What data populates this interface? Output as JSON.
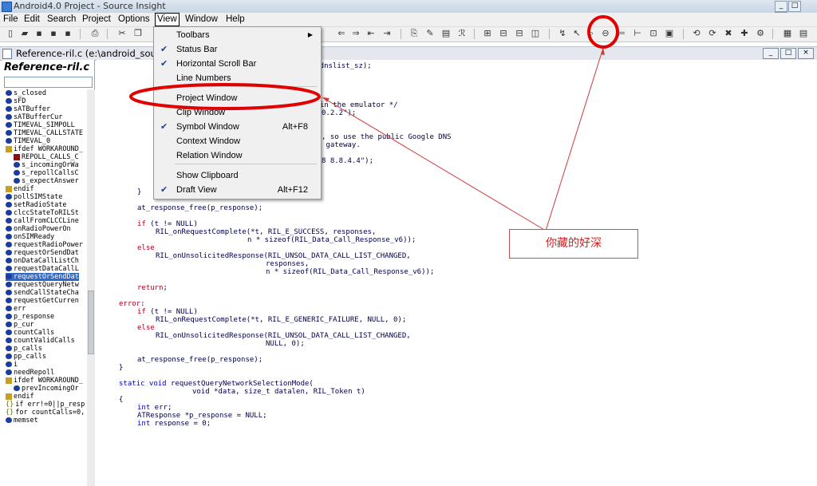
{
  "window": {
    "title": "Android4.0 Project - Source Insight"
  },
  "menubar": [
    "File",
    "Edit",
    "Search",
    "Project",
    "Options",
    "View",
    "Window",
    "Help"
  ],
  "document": {
    "title": "Reference-ril.c (e:\\android_source\\..."
  },
  "symbol_window": {
    "header": "Reference-ril.c",
    "items": [
      {
        "icon": "dot",
        "label": "s_closed"
      },
      {
        "icon": "dot",
        "label": "sFD"
      },
      {
        "icon": "dot",
        "label": "sATBuffer"
      },
      {
        "icon": "dot",
        "label": "sATBufferCur"
      },
      {
        "icon": "dot",
        "label": "TIMEVAL_SIMPOLL"
      },
      {
        "icon": "dot",
        "label": "TIMEVAL_CALLSTATE"
      },
      {
        "icon": "dot",
        "label": "TIMEVAL_0"
      },
      {
        "icon": "hash",
        "label": "ifdef WORKAROUND_"
      },
      {
        "icon": "lock",
        "label": "REPOLL_CALLS_C",
        "indent": true
      },
      {
        "icon": "dot",
        "label": "s_incomingOrWa",
        "indent": true
      },
      {
        "icon": "dot",
        "label": "s_repollCallsC",
        "indent": true
      },
      {
        "icon": "dot",
        "label": "s_expectAnswer",
        "indent": true
      },
      {
        "icon": "hash",
        "label": "endif"
      },
      {
        "icon": "dot",
        "label": "pollSIMState"
      },
      {
        "icon": "dot",
        "label": "setRadioState"
      },
      {
        "icon": "dot",
        "label": "clccStateToRILSt"
      },
      {
        "icon": "dot",
        "label": "callFromCLCCLine"
      },
      {
        "icon": "dot",
        "label": "onRadioPowerOn"
      },
      {
        "icon": "dot",
        "label": "onSIMReady"
      },
      {
        "icon": "dot",
        "label": "requestRadioPower"
      },
      {
        "icon": "dot",
        "label": "requestOrSendDat"
      },
      {
        "icon": "dot",
        "label": "onDataCallListCh"
      },
      {
        "icon": "dot",
        "label": "requestDataCallL"
      },
      {
        "icon": "dot",
        "label": "requestOrSendDat",
        "selected": true
      },
      {
        "icon": "dot",
        "label": "requestQueryNetw"
      },
      {
        "icon": "dot",
        "label": "sendCallStateCha"
      },
      {
        "icon": "dot",
        "label": "requestGetCurren"
      },
      {
        "icon": "dot",
        "label": "err"
      },
      {
        "icon": "dot",
        "label": "p_response"
      },
      {
        "icon": "dot",
        "label": "p_cur"
      },
      {
        "icon": "dot",
        "label": "countCalls"
      },
      {
        "icon": "dot",
        "label": "countValidCalls"
      },
      {
        "icon": "dot",
        "label": "p_calls"
      },
      {
        "icon": "dot",
        "label": "pp_calls"
      },
      {
        "icon": "dot",
        "label": "i"
      },
      {
        "icon": "dot",
        "label": "needRepoll"
      },
      {
        "icon": "hash",
        "label": "ifdef WORKAROUND_"
      },
      {
        "icon": "dot",
        "label": "prevIncomingOr",
        "indent": true
      },
      {
        "icon": "hash",
        "label": "endif"
      },
      {
        "icon": "brace",
        "label": "if err!=0||p_resp"
      },
      {
        "icon": "brace",
        "label": "for countCalls=0,"
      },
      {
        "icon": "dot",
        "label": "memset"
      }
    ]
  },
  "view_menu": {
    "items": [
      {
        "label": "Toolbars",
        "checked": false,
        "submenu": true,
        "shortcut": ""
      },
      {
        "label": "Status Bar",
        "checked": true,
        "submenu": false,
        "shortcut": ""
      },
      {
        "label": "Horizontal Scroll Bar",
        "checked": true,
        "submenu": false,
        "shortcut": ""
      },
      {
        "label": "Line Numbers",
        "checked": false,
        "submenu": false,
        "shortcut": ""
      },
      {
        "label": "Project Window",
        "checked": false,
        "submenu": false,
        "shortcut": ""
      },
      {
        "label": "Clip Window",
        "checked": false,
        "submenu": false,
        "shortcut": ""
      },
      {
        "label": "Symbol Window",
        "checked": true,
        "submenu": false,
        "shortcut": "Alt+F8"
      },
      {
        "label": "Context Window",
        "checked": false,
        "submenu": false,
        "shortcut": ""
      },
      {
        "label": "Relation Window",
        "checked": false,
        "submenu": false,
        "shortcut": ""
      },
      {
        "label": "Show Clipboard",
        "checked": false,
        "submenu": false,
        "shortcut": ""
      },
      {
        "label": "Draft View",
        "checked": true,
        "submenu": false,
        "shortcut": "Alt+F12"
      }
    ]
  },
  "code_fragments": {
    "l1": "ue, dnslist_sz);",
    "l2": "in the emulator */",
    "l3": "0.2.2\");",
    "l4": ", so use the public Google DNS",
    "l5": " gateway.",
    "l6": "8 8.8.4.4\");"
  },
  "code_lines": [
    {
      "indent": 1,
      "text": "}"
    },
    {
      "indent": 0,
      "text": ""
    },
    {
      "indent": 1,
      "text": "at_response_free(p_response);"
    },
    {
      "indent": 0,
      "text": ""
    },
    {
      "indent": 1,
      "kw": "if",
      "text": " (t != NULL)"
    },
    {
      "indent": 2,
      "text": "RIL_onRequestComplete(*t, RIL_E_SUCCESS, responses,"
    },
    {
      "indent": 7,
      "text": "n * sizeof(RIL_Data_Call_Response_v6));"
    },
    {
      "indent": 1,
      "kw": "else",
      "text": ""
    },
    {
      "indent": 2,
      "text": "RIL_onUnsolicitedResponse(RIL_UNSOL_DATA_CALL_LIST_CHANGED,"
    },
    {
      "indent": 8,
      "text": "responses,"
    },
    {
      "indent": 8,
      "text": "n * sizeof(RIL_Data_Call_Response_v6));"
    },
    {
      "indent": 0,
      "text": ""
    },
    {
      "indent": 1,
      "kw": "return",
      "text": ";"
    },
    {
      "indent": 0,
      "text": ""
    },
    {
      "indent": 0,
      "kw": "error",
      "text": ":"
    },
    {
      "indent": 1,
      "kw": "if",
      "text": " (t != NULL)"
    },
    {
      "indent": 2,
      "text": "RIL_onRequestComplete(*t, RIL_E_GENERIC_FAILURE, NULL, 0);"
    },
    {
      "indent": 1,
      "kw": "else",
      "text": ""
    },
    {
      "indent": 2,
      "text": "RIL_onUnsolicitedResponse(RIL_UNSOL_DATA_CALL_LIST_CHANGED,"
    },
    {
      "indent": 8,
      "text": "NULL, 0);"
    },
    {
      "indent": 0,
      "text": ""
    },
    {
      "indent": 1,
      "text": "at_response_free(p_response);"
    },
    {
      "indent": 0,
      "text": "}"
    },
    {
      "indent": 0,
      "text": ""
    },
    {
      "indent": 0,
      "kwb": "static void",
      "text": " requestQueryNetworkSelectionMode("
    },
    {
      "indent": 4,
      "text": "void *data, size_t datalen, RIL_Token t)"
    },
    {
      "indent": 0,
      "text": "{"
    },
    {
      "indent": 1,
      "kwb": "int",
      "text": " err;"
    },
    {
      "indent": 1,
      "text": "ATResponse *p_response = NULL;"
    },
    {
      "indent": 1,
      "kwb": "int",
      "text": " response = 0;"
    }
  ],
  "annotation": {
    "callout_text": "你藏的好深",
    "color": "#cc2020"
  }
}
